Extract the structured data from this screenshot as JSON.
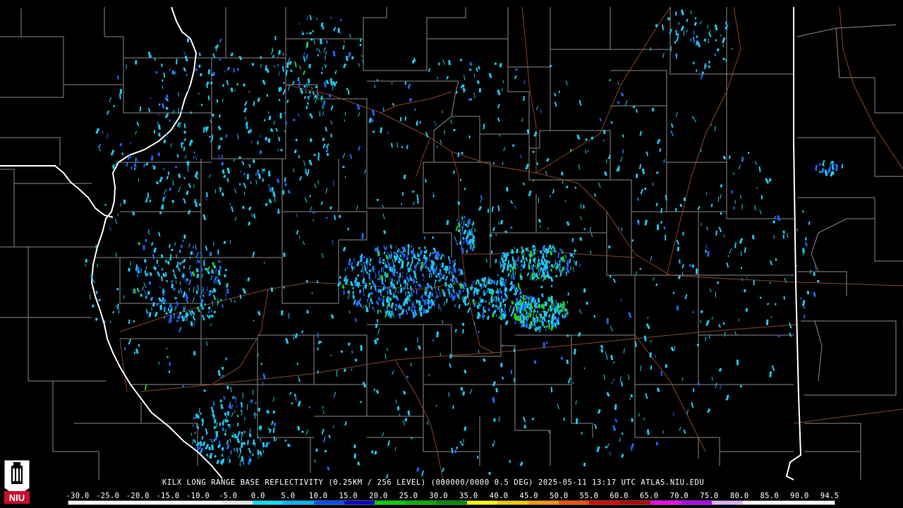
{
  "map": {
    "caption": "KILX LONG RANGE BASE REFLECTIVITY (0.25KM / 256 LEVEL) (000000/0000 0.5 DEG) 2025-05-11 13:17 UTC  ATLAS.NIU.EDU",
    "colors": {
      "background": "#000000",
      "county_lines": "#8a8a8a",
      "state_lines": "#ffffff",
      "highways": "#a0522d",
      "echo_light": "#1ec8f0",
      "echo_medium": "#1e64ff",
      "echo_strong": "#22cc22"
    },
    "scale": {
      "labels": [
        "-30.0",
        "-25.0",
        "-20.0",
        "-15.0",
        "-10.0",
        "-5.0",
        "0.0",
        "5.0",
        "10.0",
        "15.0",
        "20.0",
        "25.0",
        "30.0",
        "35.0",
        "40.0",
        "45.0",
        "50.0",
        "55.0",
        "60.0",
        "65.0",
        "70.0",
        "75.0",
        "80.0",
        "85.0",
        "90.0",
        "94.5"
      ],
      "colors": [
        "#ffffff",
        "#ffffff",
        "#ffffff",
        "#ffffff",
        "#ffffff",
        "#e8e8e8",
        "#00e0ff",
        "#00b4ff",
        "#0050ff",
        "#0000c8",
        "#00d000",
        "#00b000",
        "#008c00",
        "#ffff00",
        "#f0c800",
        "#ff9600",
        "#ff5000",
        "#e00000",
        "#b40000",
        "#ff00ff",
        "#b400ff",
        "#e0b0ff",
        "#ffffff",
        "#ffffff",
        "#ffffff"
      ]
    },
    "logo": {
      "text": "NIU",
      "icon": "niu-tower-logo-icon"
    }
  }
}
